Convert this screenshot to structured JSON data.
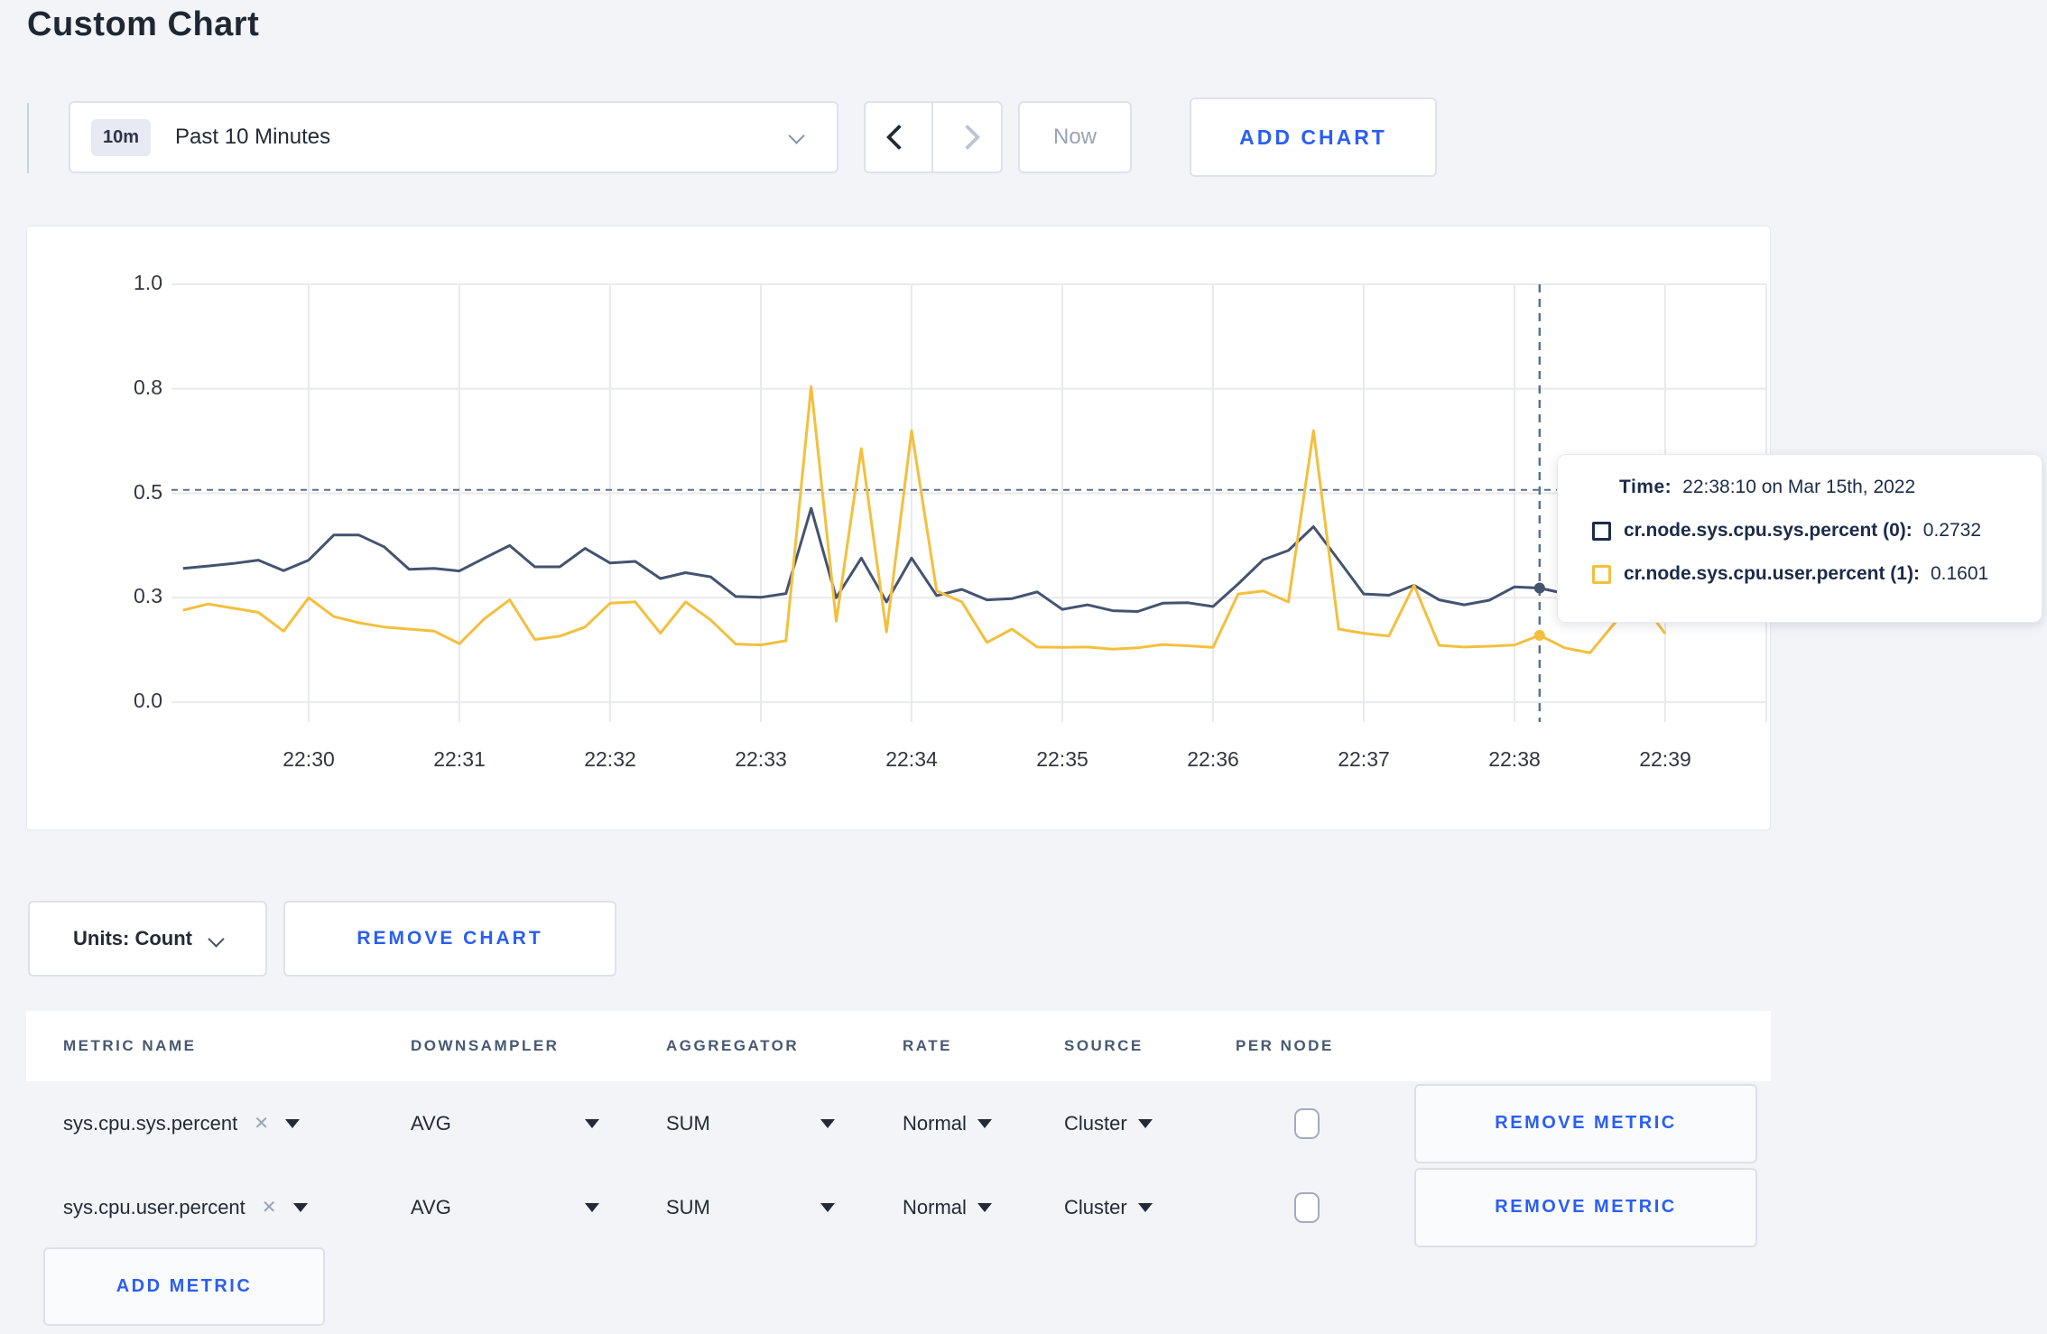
{
  "page": {
    "title": "Custom Chart"
  },
  "toolbar": {
    "time_badge": "10m",
    "time_label": "Past 10 Minutes",
    "back_enabled": true,
    "forward_enabled": false,
    "now_label": "Now",
    "add_chart_label": "ADD CHART"
  },
  "chart_data": {
    "type": "line",
    "title": "",
    "xlabel": "",
    "ylabel": "",
    "grid": true,
    "legend_position": "tooltip-only",
    "y_axis_actual_range": [
      0,
      1
    ],
    "y_ticks": [
      {
        "label": "1.0",
        "v": 1.0
      },
      {
        "label": "0.8",
        "v": 0.75
      },
      {
        "label": "0.5",
        "v": 0.5
      },
      {
        "label": "0.3",
        "v": 0.25
      },
      {
        "label": "0.0",
        "v": 0.0
      }
    ],
    "x_ticks": [
      {
        "label": "22:30",
        "sec": 0
      },
      {
        "label": "22:31",
        "sec": 60
      },
      {
        "label": "22:32",
        "sec": 120
      },
      {
        "label": "22:33",
        "sec": 180
      },
      {
        "label": "22:34",
        "sec": 240
      },
      {
        "label": "22:35",
        "sec": 300
      },
      {
        "label": "22:36",
        "sec": 360
      },
      {
        "label": "22:37",
        "sec": 420
      },
      {
        "label": "22:38",
        "sec": 480
      },
      {
        "label": "22:39",
        "sec": 540
      }
    ],
    "x_seconds_from_2230": [
      -50,
      -40,
      -30,
      -20,
      -10,
      0,
      10,
      20,
      30,
      40,
      50,
      60,
      70,
      80,
      90,
      100,
      110,
      120,
      130,
      140,
      150,
      160,
      170,
      180,
      190,
      200,
      210,
      220,
      230,
      240,
      250,
      260,
      270,
      280,
      290,
      300,
      310,
      320,
      330,
      340,
      350,
      360,
      370,
      380,
      390,
      400,
      410,
      420,
      430,
      440,
      450,
      460,
      470,
      480,
      490,
      500,
      510,
      520,
      530,
      540
    ],
    "series": [
      {
        "name": "cr.node.sys.cpu.sys.percent (0)",
        "color": "#44536f",
        "values": [
          0.32,
          0.326,
          0.332,
          0.34,
          0.315,
          0.34,
          0.4,
          0.4,
          0.372,
          0.318,
          0.32,
          0.314,
          0.345,
          0.375,
          0.324,
          0.324,
          0.368,
          0.333,
          0.337,
          0.296,
          0.31,
          0.3,
          0.253,
          0.251,
          0.26,
          0.464,
          0.25,
          0.345,
          0.24,
          0.345,
          0.255,
          0.27,
          0.245,
          0.248,
          0.264,
          0.222,
          0.233,
          0.219,
          0.217,
          0.237,
          0.238,
          0.229,
          0.283,
          0.341,
          0.363,
          0.42,
          0.34,
          0.259,
          0.256,
          0.28,
          0.245,
          0.233,
          0.244,
          0.276,
          0.2732,
          0.26,
          0.272,
          0.29,
          0.302,
          0.3
        ]
      },
      {
        "name": "cr.node.sys.cpu.user.percent (1)",
        "color": "#f3bf3d",
        "values": [
          0.22,
          0.235,
          0.225,
          0.215,
          0.17,
          0.25,
          0.205,
          0.19,
          0.18,
          0.175,
          0.17,
          0.14,
          0.2,
          0.245,
          0.15,
          0.158,
          0.18,
          0.237,
          0.24,
          0.165,
          0.24,
          0.197,
          0.139,
          0.137,
          0.147,
          0.755,
          0.194,
          0.607,
          0.168,
          0.65,
          0.266,
          0.24,
          0.143,
          0.175,
          0.132,
          0.131,
          0.132,
          0.127,
          0.13,
          0.138,
          0.135,
          0.131,
          0.259,
          0.266,
          0.24,
          0.65,
          0.175,
          0.165,
          0.158,
          0.28,
          0.136,
          0.132,
          0.134,
          0.137,
          0.1601,
          0.13,
          0.118,
          0.19,
          0.245,
          0.164
        ]
      }
    ],
    "crosshair": {
      "x_seconds_from_2230": 490,
      "hover_value_line": 0.508,
      "dot_values": [
        0.2732,
        0.1601
      ]
    }
  },
  "tooltip": {
    "time_label": "Time:",
    "time_value": "22:38:10 on Mar 15th, 2022",
    "rows": [
      {
        "label": "cr.node.sys.cpu.sys.percent (0):",
        "value": "0.2732",
        "color": "#1c2b4a"
      },
      {
        "label": "cr.node.sys.cpu.user.percent (1):",
        "value": "0.1601",
        "color": "#f3bf3d"
      }
    ]
  },
  "chart_controls": {
    "units_label": "Units: Count",
    "remove_chart_label": "REMOVE CHART"
  },
  "metrics_table": {
    "headers": [
      "METRIC NAME",
      "DOWNSAMPLER",
      "AGGREGATOR",
      "RATE",
      "SOURCE",
      "PER NODE"
    ],
    "rows": [
      {
        "metric": "sys.cpu.sys.percent",
        "downsampler": "AVG",
        "aggregator": "SUM",
        "rate": "Normal",
        "source": "Cluster",
        "per_node_checked": false,
        "remove_label": "REMOVE METRIC"
      },
      {
        "metric": "sys.cpu.user.percent",
        "downsampler": "AVG",
        "aggregator": "SUM",
        "rate": "Normal",
        "source": "Cluster",
        "per_node_checked": false,
        "remove_label": "REMOVE METRIC"
      }
    ],
    "add_metric_label": "ADD METRIC"
  },
  "icons": {
    "close_x": "✕"
  },
  "colors": {
    "accent_blue": "#2a5ef5",
    "series_sys": "#44536f",
    "series_user": "#f3bf3d",
    "crosshair": "#5a7290",
    "gridline": "#e9eaee"
  }
}
